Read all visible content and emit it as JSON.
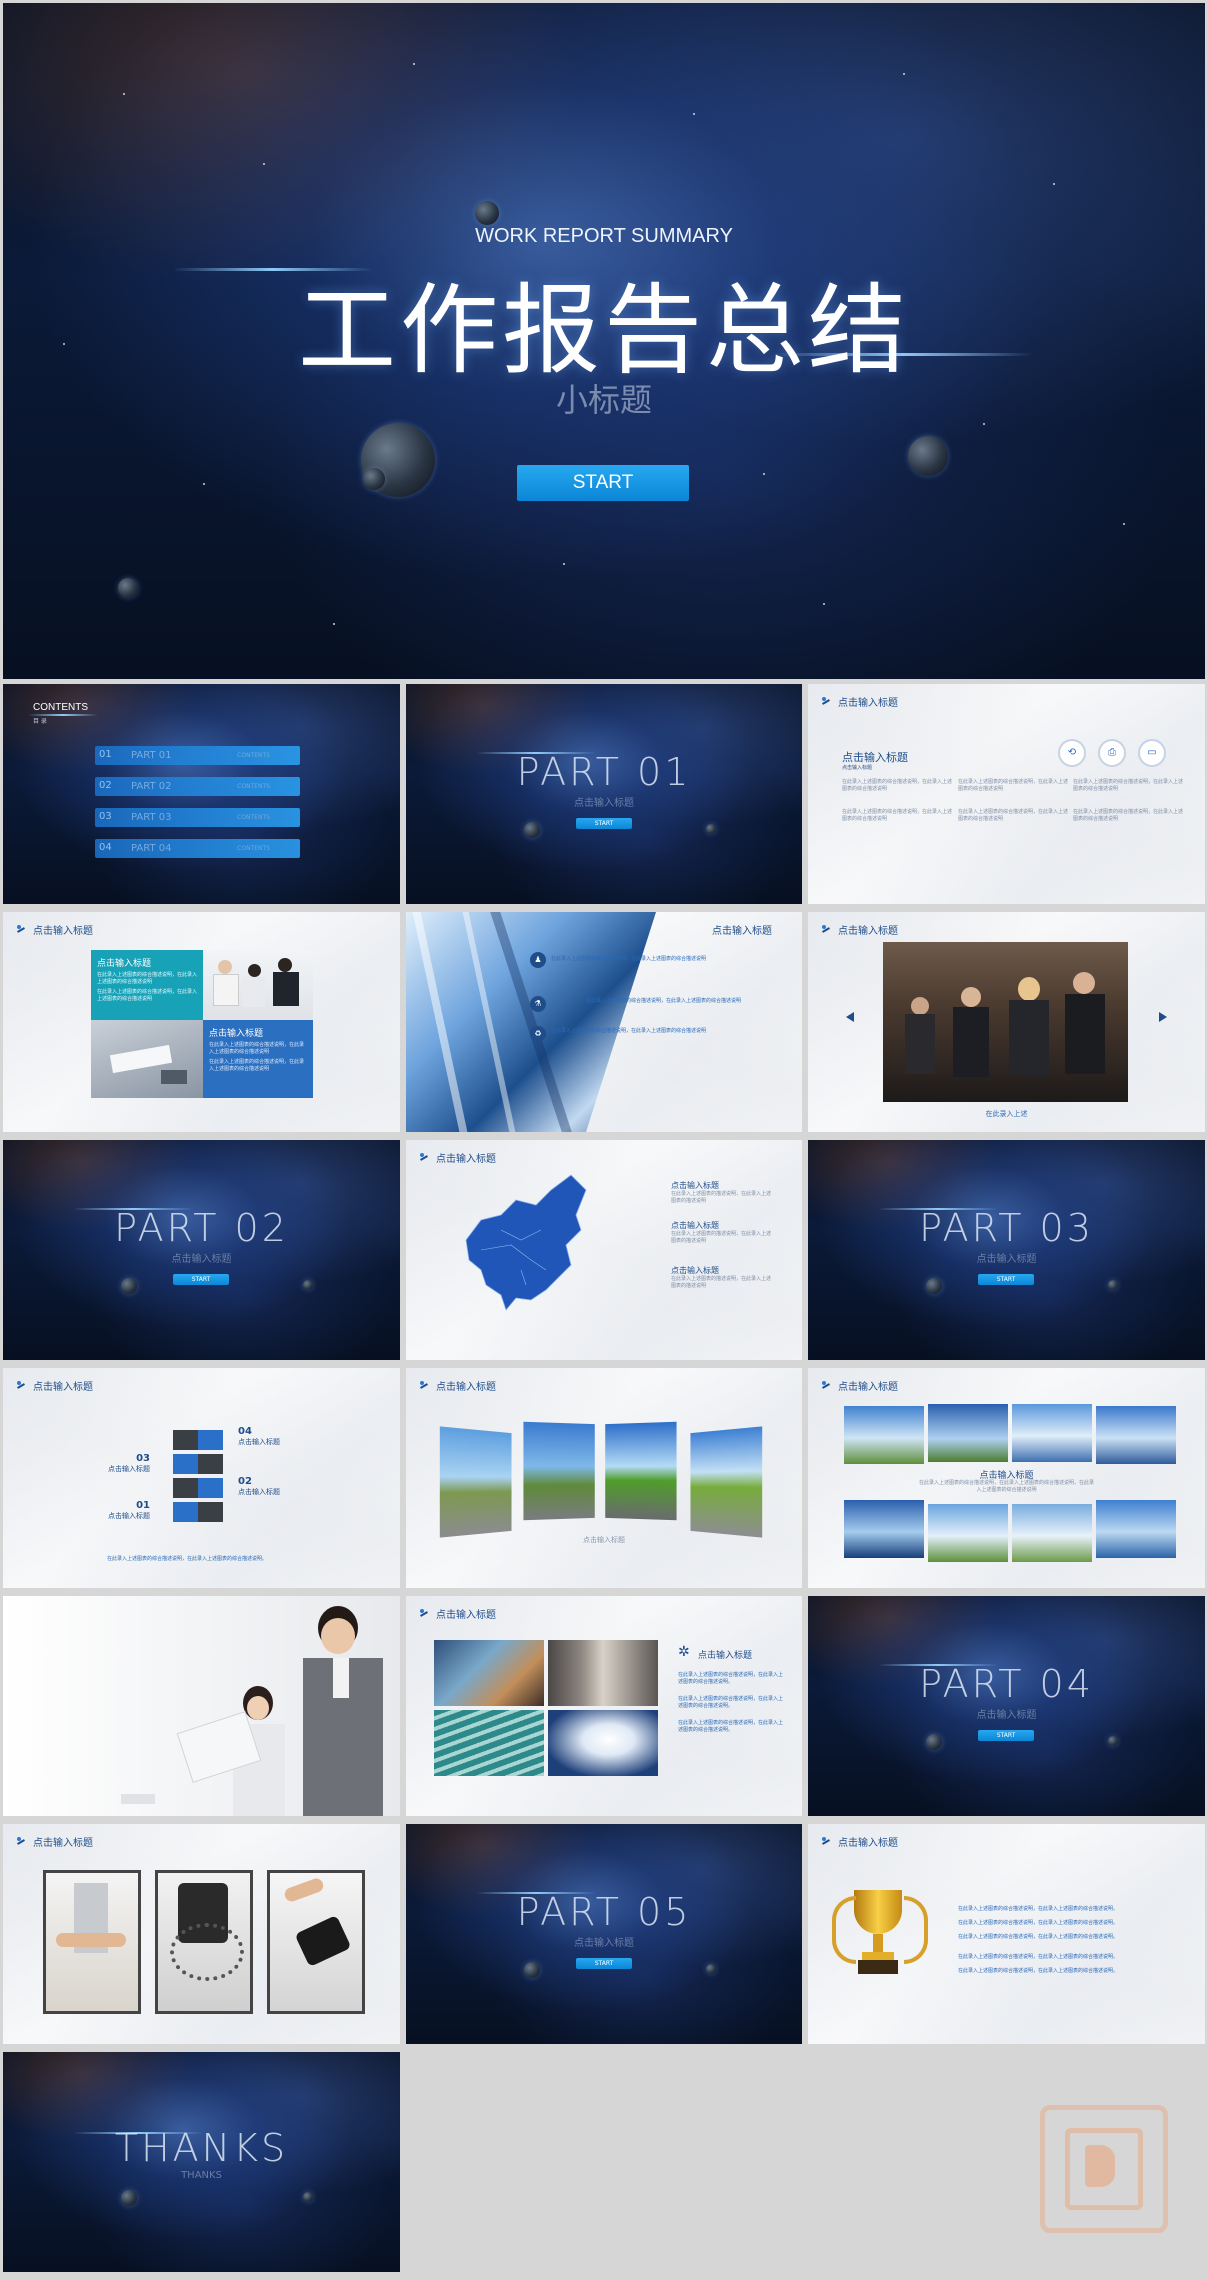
{
  "cover": {
    "en_title": "WORK REPORT SUMMARY",
    "title": "工作报告总结",
    "subtitle": "小标题",
    "start": "START"
  },
  "contents": {
    "label": "CONTENTS",
    "label_cn": "目 录",
    "items": [
      {
        "num": "01",
        "part": "PART 01",
        "text": "CONTENTS"
      },
      {
        "num": "02",
        "part": "PART 02",
        "text": "CONTENTS"
      },
      {
        "num": "03",
        "part": "PART 03",
        "text": "CONTENTS"
      },
      {
        "num": "04",
        "part": "PART 04",
        "text": "CONTENTS"
      }
    ]
  },
  "parts": [
    {
      "title": "PART  01",
      "sub": "点击输入标题",
      "btn": "START"
    },
    {
      "title": "PART  02",
      "sub": "点击输入标题",
      "btn": "START"
    },
    {
      "title": "PART  03",
      "sub": "点击输入标题",
      "btn": "START"
    },
    {
      "title": "PART  04",
      "sub": "点击输入标题",
      "btn": "START"
    },
    {
      "title": "PART  05",
      "sub": "点击输入标题",
      "btn": "START"
    }
  ],
  "header_label": "点击输入标题",
  "slide_icons": {
    "title": "点击输入标题",
    "sub": "点击输入标题",
    "body": "在此录入上述图表的综合描述说明，在此录入上述图表的综合描述说明"
  },
  "slide_team": {
    "box1_title": "点击输入标题",
    "box2_title": "点击输入标题",
    "body": "在此录入上述图表的综合描述说明，在此录入上述图表的综合描述说明"
  },
  "slide_carousel": {
    "caption": "在此录入上述"
  },
  "slide_map": {
    "items": [
      {
        "title": "点击输入标题",
        "text": "在此录入上述图表的描述说明，在此录入上述图表的描述说明"
      },
      {
        "title": "点击输入标题",
        "text": "在此录入上述图表的描述说明，在此录入上述图表的描述说明"
      },
      {
        "title": "点击输入标题",
        "text": "在此录入上述图表的描述说明，在此录入上述图表的描述说明"
      }
    ]
  },
  "slide_cubes": {
    "labels": [
      {
        "num": "04",
        "text": "点击输入标题"
      },
      {
        "num": "03",
        "text": "点击输入标题"
      },
      {
        "num": "02",
        "text": "点击输入标题"
      },
      {
        "num": "01",
        "text": "点击输入标题"
      }
    ],
    "footer": "在此录入上述图表的综合描述说明，在此录入上述图表的综合描述说明。"
  },
  "slide_roads": {
    "caption": "点击输入标题"
  },
  "slide_wind": {
    "title": "点击输入标题",
    "text": "在此录入上述图表的综合描述说明，在此录入上述图表的综合描述说明，在此录入上述图表的综合描述说明"
  },
  "slide_buildings": {
    "title": "点击输入标题",
    "text": "在此录入上述图表的综合描述说明，在此录入上述图表的综合描述说明。"
  },
  "slide_trophy": {
    "text": "在此录入上述图表的综合描述说明，在此录入上述图表的综合描述说明。"
  },
  "thanks": {
    "title": "THANKS",
    "sub": "THANKS"
  },
  "colors": {
    "accent": "#1a8fe0",
    "dark_blue": "#1f4d8a",
    "bg": "#d6d6d6"
  }
}
